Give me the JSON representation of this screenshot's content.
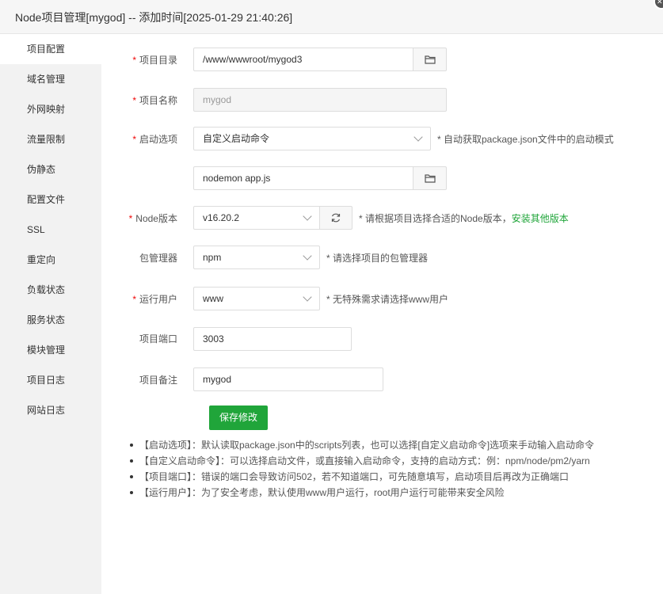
{
  "window": {
    "title": "Node项目管理[mygod] -- 添加时间[2025-01-29 21:40:26]"
  },
  "sidebar": {
    "items": [
      {
        "label": "项目配置",
        "active": true
      },
      {
        "label": "域名管理"
      },
      {
        "label": "外网映射"
      },
      {
        "label": "流量限制"
      },
      {
        "label": "伪静态"
      },
      {
        "label": "配置文件"
      },
      {
        "label": "SSL"
      },
      {
        "label": "重定向"
      },
      {
        "label": "负载状态"
      },
      {
        "label": "服务状态"
      },
      {
        "label": "模块管理"
      },
      {
        "label": "项目日志"
      },
      {
        "label": "网站日志"
      }
    ]
  },
  "form": {
    "project_dir": {
      "label": "项目目录",
      "required": "*",
      "value": "/www/wwwroot/mygod3"
    },
    "project_name": {
      "label": "项目名称",
      "required": "*",
      "value": "mygod"
    },
    "start_option": {
      "label": "启动选项",
      "required": "*",
      "value": "自定义启动命令",
      "hint": "* 自动获取package.json文件中的启动模式"
    },
    "start_command": {
      "value": "nodemon app.js"
    },
    "node_version": {
      "label": "Node版本",
      "required": "*",
      "value": "v16.20.2",
      "hint": "* 请根据项目选择合适的Node版本，",
      "link": "安装其他版本"
    },
    "package_manager": {
      "label": "包管理器",
      "value": "npm",
      "hint": "* 请选择项目的包管理器"
    },
    "run_user": {
      "label": "运行用户",
      "required": "*",
      "value": "www",
      "hint": "* 无特殊需求请选择www用户"
    },
    "project_port": {
      "label": "项目端口",
      "value": "3003"
    },
    "project_note": {
      "label": "项目备注",
      "value": "mygod"
    },
    "save_label": "保存修改"
  },
  "tips": [
    "【启动选项】：默认读取package.json中的scripts列表，也可以选择[自定义启动命令]选项来手动输入启动命令",
    "【自定义启动命令】：可以选择启动文件，或直接输入启动命令，支持的启动方式：例：npm/node/pm2/yarn",
    "【项目端口】：错误的端口会导致访问502，若不知道端口，可先随意填写，启动项目后再改为正确端口",
    "【运行用户】：为了安全考虑，默认使用www用户运行，root用户运行可能带来安全风险"
  ],
  "colors": {
    "accent": "#20a53a",
    "required": "#ef0808",
    "sidebar_bg": "#f2f2f2"
  }
}
